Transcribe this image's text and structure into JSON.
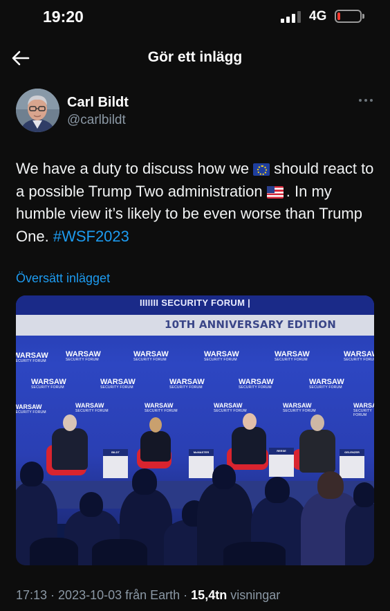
{
  "status_bar": {
    "time": "19:20",
    "network": "4G",
    "signal_icon": "cellular-signal-icon",
    "battery_icon": "battery-low-icon",
    "battery_level": 0.1,
    "battery_color": "#ff3b30"
  },
  "header": {
    "title": "Gör ett inlägg",
    "back_icon": "arrow-left-icon"
  },
  "tweet": {
    "author_name": "Carl Bildt",
    "author_handle": "@carlbildt",
    "more_icon": "more-horizontal-icon",
    "text_part1": "We have a duty to discuss how we",
    "text_part2": "should react to a possible Trump Two administration",
    "text_part3": ". In my humble view it’s likely to be even worse than Trump One.",
    "flag1_icon": "eu-flag-emoji",
    "flag2_icon": "us-flag-emoji",
    "hashtag": "#WSF2023",
    "translate_label": "Översätt inlägget",
    "link_color": "#1d9bf0",
    "meta_time": "17:13",
    "meta_sep1": " · ",
    "meta_date": "2023-10-03",
    "meta_source": " från Earth",
    "meta_sep2": " · ",
    "meta_views": "15,4tn",
    "meta_views_label": " visningar"
  },
  "media": {
    "banner_title": "IIIIIII SECURITY FORUM    |",
    "anniversary_text": "10TH ANNIVERSARY EDITION",
    "logo_text": "WARSAW",
    "logo_sub": "SECURITY FORUM",
    "nameplates": [
      "BILDT",
      "McMASTER",
      "REESE",
      "GELENZER"
    ]
  }
}
